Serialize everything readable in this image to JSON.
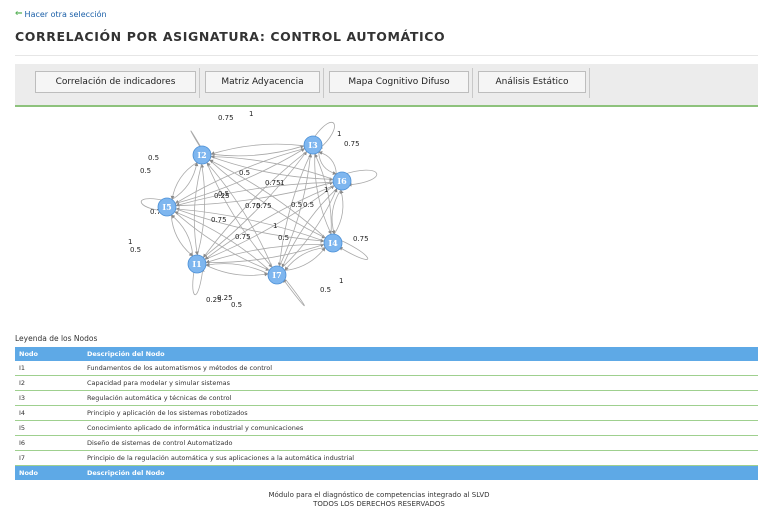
{
  "back_link": {
    "label": "Hacer otra selección"
  },
  "title": "CORRELACIÓN POR ASIGNATURA: CONTROL AUTOMÁTICO",
  "tabs": [
    {
      "label": "Correlación de indicadores"
    },
    {
      "label": "Matriz Adyacencia"
    },
    {
      "label": "Mapa Cognitivo Difuso"
    },
    {
      "label": "Análisis Estático"
    }
  ],
  "graph": {
    "nodes": [
      "I1",
      "I2",
      "I3",
      "I4",
      "I5",
      "I6",
      "I7"
    ],
    "weight_labels": [
      "0.75",
      "1",
      "1",
      "0.75",
      "0.5",
      "0.5",
      "0.5",
      "0.75",
      "0.5",
      "1",
      "0.25",
      "0.75",
      "0.75",
      "0.5",
      "0.5",
      "0.75",
      "0.75",
      "0.5",
      "0.75",
      "1",
      "0.5",
      "1",
      "0.25",
      "0.5",
      "0.5",
      "0.25",
      "1",
      "1",
      "0.75"
    ]
  },
  "legend": {
    "caption": "Leyenda de los Nodos",
    "col_node": "Nodo",
    "col_desc": "Descripción del Nodo",
    "rows": [
      {
        "node": "I1",
        "desc": "Fundamentos de los automatismos y métodos de control"
      },
      {
        "node": "I2",
        "desc": "Capacidad para modelar y simular sistemas"
      },
      {
        "node": "I3",
        "desc": "Regulación automática y técnicas de control"
      },
      {
        "node": "I4",
        "desc": "Principio y aplicación de los sistemas robotizados"
      },
      {
        "node": "I5",
        "desc": "Conocimiento aplicado de informática industrial y comunicaciones"
      },
      {
        "node": "I6",
        "desc": "Diseño de sistemas de control Automatizado"
      },
      {
        "node": "I7",
        "desc": "Principio de la regulación automática y sus aplicaciones a la automática industrial"
      }
    ]
  },
  "footer": {
    "line1": "Módulo para el diagnóstico de competencias integrado al SLVD",
    "line2": "TODOS LOS DERECHOS RESERVADOS"
  },
  "colors": {
    "accent": "#5ea9e6",
    "node_fill": "#7eb6ef",
    "rule": "#8dc27c",
    "link": "#1a5fa8"
  }
}
